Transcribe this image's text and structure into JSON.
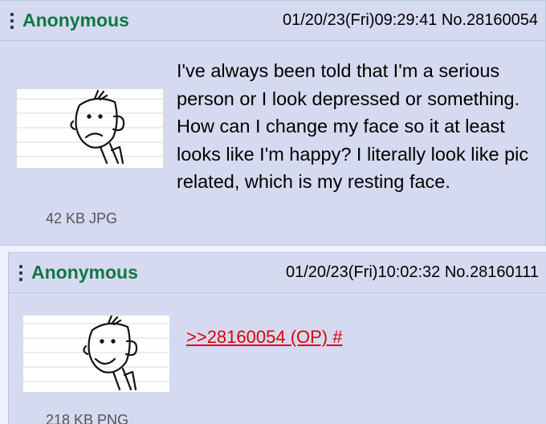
{
  "posts": [
    {
      "name": "Anonymous",
      "datetime": "01/20/23(Fri)09:29:41",
      "number": "No.28160054",
      "file_size": "42 KB JPG",
      "thumbnail_icon": "sad-cartoon-face-icon",
      "body": "I've always been told that I'm a serious person or I look depressed or something. How can I change my face so it at least looks like I'm happy? I literally look like pic related, which is my resting face."
    },
    {
      "name": "Anonymous",
      "datetime": "01/20/23(Fri)10:02:32",
      "number": "No.28160111",
      "file_size": "218 KB PNG",
      "thumbnail_icon": "smiling-cartoon-face-icon",
      "quote_link": ">>28160054 (OP) #"
    }
  ],
  "colors": {
    "page_bg": "#eef2ff",
    "post_bg": "#d6daf0",
    "border": "#b7c5d9",
    "name": "#117743",
    "quote_link": "#dd0000"
  }
}
